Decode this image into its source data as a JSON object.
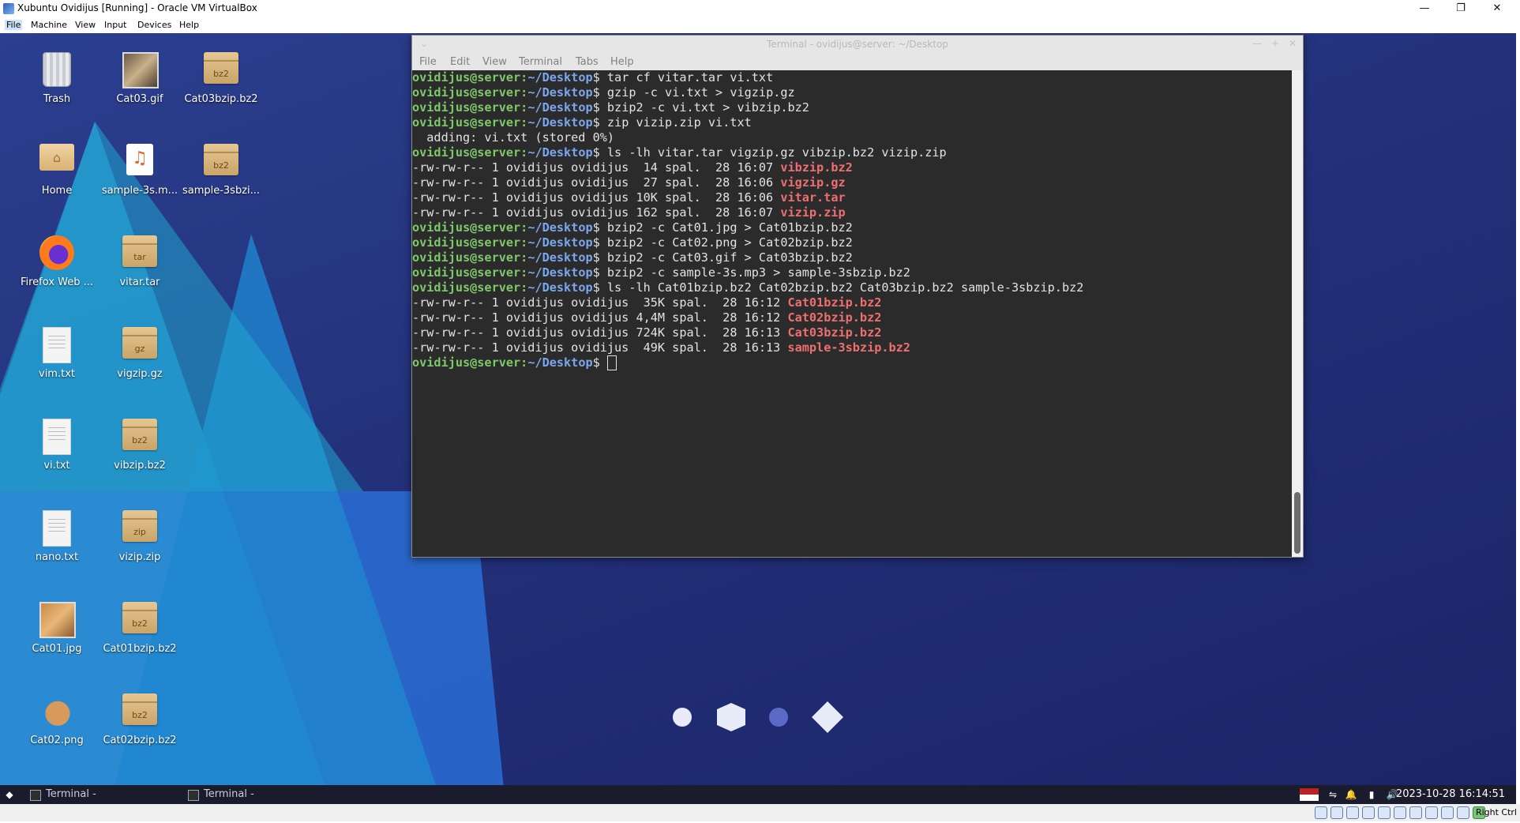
{
  "vbox": {
    "title": "Xubuntu Ovidijus [Running] - Oracle VM VirtualBox",
    "menu": [
      "File",
      "Machine",
      "View",
      "Input",
      "Devices",
      "Help"
    ],
    "minimize_glyph": "—",
    "restore_glyph": "❐",
    "close_glyph": "✕",
    "host_key": "Right Ctrl"
  },
  "desktop": {
    "icons": [
      {
        "label": "Trash",
        "type": "trash"
      },
      {
        "label": "Cat03.gif",
        "type": "image"
      },
      {
        "label": "Cat03bzip.bz2",
        "type": "archive",
        "badge": "bz2"
      },
      {
        "label": "Home",
        "type": "folder"
      },
      {
        "label": "sample-3s.m...",
        "type": "audio"
      },
      {
        "label": "sample-3sbzi...",
        "type": "archive",
        "badge": "bz2"
      },
      {
        "label": "Firefox Web ...",
        "type": "firefox"
      },
      {
        "label": "vitar.tar",
        "type": "archive",
        "badge": "tar"
      },
      {
        "label": "vim.txt",
        "type": "text"
      },
      {
        "label": "vigzip.gz",
        "type": "archive",
        "badge": "gz"
      },
      {
        "label": "vi.txt",
        "type": "text"
      },
      {
        "label": "vibzip.bz2",
        "type": "archive",
        "badge": "bz2"
      },
      {
        "label": "nano.txt",
        "type": "text"
      },
      {
        "label": "vizip.zip",
        "type": "archive",
        "badge": "zip"
      },
      {
        "label": "Cat01.jpg",
        "type": "image"
      },
      {
        "label": "Cat01bzip.bz2",
        "type": "archive",
        "badge": "bz2"
      },
      {
        "label": "Cat02.png",
        "type": "image"
      },
      {
        "label": "Cat02bzip.bz2",
        "type": "archive",
        "badge": "bz2"
      }
    ]
  },
  "terminal": {
    "title": "Terminal - ovidijus@server: ~/Desktop",
    "menu": [
      "File",
      "Edit",
      "View",
      "Terminal",
      "Tabs",
      "Help"
    ],
    "prompt_user": "ovidijus@server",
    "prompt_sep": ":",
    "prompt_path": "~/Desktop",
    "prompt_end": "$ ",
    "lines": [
      {
        "kind": "cmd",
        "text": "tar cf vitar.tar vi.txt"
      },
      {
        "kind": "cmd",
        "text": "gzip -c vi.txt > vigzip.gz"
      },
      {
        "kind": "cmd",
        "text": "bzip2 -c vi.txt > vibzip.bz2"
      },
      {
        "kind": "cmd",
        "text": "zip vizip.zip vi.txt"
      },
      {
        "kind": "out",
        "text": "  adding: vi.txt (stored 0%)"
      },
      {
        "kind": "cmd",
        "text": "ls -lh vitar.tar vigzip.gz vibzip.bz2 vizip.zip"
      },
      {
        "kind": "ls",
        "text": "-rw-rw-r-- 1 ovidijus ovidijus  14 spal.  28 16:07 ",
        "file": "vibzip.bz2"
      },
      {
        "kind": "ls",
        "text": "-rw-rw-r-- 1 ovidijus ovidijus  27 spal.  28 16:06 ",
        "file": "vigzip.gz"
      },
      {
        "kind": "ls",
        "text": "-rw-rw-r-- 1 ovidijus ovidijus 10K spal.  28 16:06 ",
        "file": "vitar.tar"
      },
      {
        "kind": "ls",
        "text": "-rw-rw-r-- 1 ovidijus ovidijus 162 spal.  28 16:07 ",
        "file": "vizip.zip"
      },
      {
        "kind": "cmd",
        "text": "bzip2 -c Cat01.jpg > Cat01bzip.bz2"
      },
      {
        "kind": "cmd",
        "text": "bzip2 -c Cat02.png > Cat02bzip.bz2"
      },
      {
        "kind": "cmd",
        "text": "bzip2 -c Cat03.gif > Cat03bzip.bz2"
      },
      {
        "kind": "cmd",
        "text": "bzip2 -c sample-3s.mp3 > sample-3sbzip.bz2"
      },
      {
        "kind": "cmd",
        "text": "ls -lh Cat01bzip.bz2 Cat02bzip.bz2 Cat03bzip.bz2 sample-3sbzip.bz2"
      },
      {
        "kind": "ls",
        "text": "-rw-rw-r-- 1 ovidijus ovidijus  35K spal.  28 16:12 ",
        "file": "Cat01bzip.bz2"
      },
      {
        "kind": "ls",
        "text": "-rw-rw-r-- 1 ovidijus ovidijus 4,4M spal.  28 16:12 ",
        "file": "Cat02bzip.bz2"
      },
      {
        "kind": "ls",
        "text": "-rw-rw-r-- 1 ovidijus ovidijus 724K spal.  28 16:13 ",
        "file": "Cat03bzip.bz2"
      },
      {
        "kind": "ls",
        "text": "-rw-rw-r-- 1 ovidijus ovidijus  49K spal.  28 16:13 ",
        "file": "sample-3sbzip.bz2"
      },
      {
        "kind": "prompt",
        "text": ""
      }
    ]
  },
  "panel": {
    "tasks": [
      "Terminal - ovidijus@serve...",
      "Terminal - ovidijus@serve..."
    ],
    "clock": "2023-10-28 16:14:51"
  },
  "colors": {
    "prompt_user": "#7ec96a",
    "prompt_path": "#7aa7ee",
    "archive_file": "#ee6f6f",
    "terminal_bg": "#2b2b2b",
    "desktop_bg": "#23317a"
  }
}
